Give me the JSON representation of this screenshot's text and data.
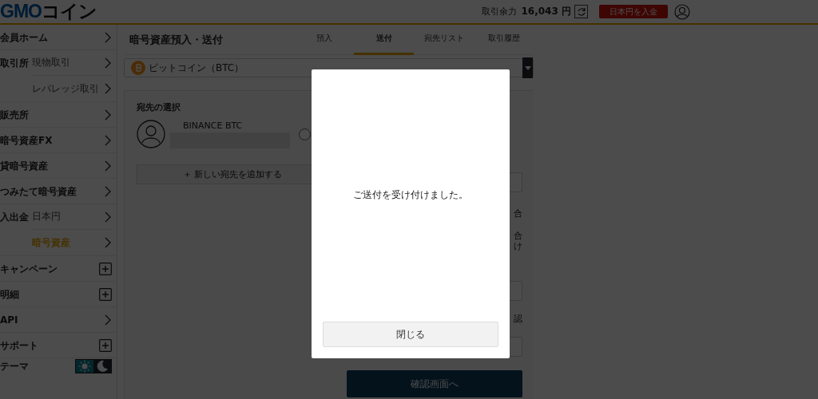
{
  "header": {
    "logo": {
      "brand": "GMO",
      "name": "コイン"
    },
    "balance_label": "取引余力",
    "balance_value": "16,043 円",
    "deposit_button": "日本円を入金"
  },
  "sidebar": {
    "items": [
      {
        "label": "会員ホーム",
        "kind": "link"
      },
      {
        "label": "取引所",
        "kind": "group",
        "children": [
          {
            "label": "現物取引",
            "selected": false
          },
          {
            "label": "レバレッジ取引",
            "selected": false
          }
        ]
      },
      {
        "label": "販売所",
        "kind": "link"
      },
      {
        "label": "暗号資産FX",
        "kind": "link"
      },
      {
        "label": "貸暗号資産",
        "kind": "link"
      },
      {
        "label": "つみたて暗号資産",
        "kind": "link"
      },
      {
        "label": "入出金",
        "kind": "group",
        "children": [
          {
            "label": "日本円",
            "selected": false
          },
          {
            "label": "暗号資産",
            "selected": true
          }
        ]
      },
      {
        "label": "キャンペーン",
        "kind": "expand"
      },
      {
        "label": "明細",
        "kind": "expand"
      },
      {
        "label": "API",
        "kind": "link"
      },
      {
        "label": "サポート",
        "kind": "expand"
      },
      {
        "label": "テーマ",
        "kind": "theme",
        "options": [
          {
            "kind": "sun",
            "selected": true
          },
          {
            "kind": "moon",
            "selected": false
          }
        ]
      }
    ]
  },
  "page": {
    "title": "暗号資産預入・送付",
    "tabs": [
      {
        "label": "預入",
        "selected": false
      },
      {
        "label": "送付",
        "selected": true
      },
      {
        "label": "宛先リスト",
        "selected": false
      },
      {
        "label": "取引履歴",
        "selected": false
      }
    ],
    "currency_select": {
      "value": "ビットコイン（BTC）"
    },
    "destination": {
      "heading": "宛先の選択",
      "name": "BINANCE BTC",
      "selected": false,
      "add_button": "＋ 新しい宛先を追加する"
    },
    "form_fragments": [
      "合",
      "合",
      "け",
      "認"
    ],
    "confirm_button": "確認画面へ"
  },
  "modal": {
    "message": "ご送付を受け付けました。",
    "close_button": "閉じる"
  }
}
